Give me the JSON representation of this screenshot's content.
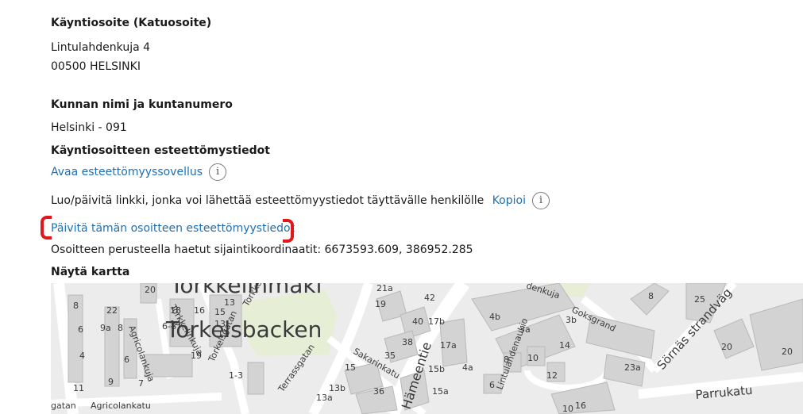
{
  "visiting_address": {
    "heading": "Käyntiosoite (Katuosoite)",
    "street": "Lintulahdenkuja 4",
    "postal": "00500 HELSINKI"
  },
  "municipality": {
    "heading": "Kunnan nimi ja kuntanumero",
    "value": "Helsinki - 091"
  },
  "accessibility": {
    "heading": "Käyntiosoitteen esteettömystiedot",
    "open_app_link": "Avaa esteettömyyssovellus",
    "share_text": "Luo/päivitä linkki, jonka voi lähettää esteettömyystiedot täyttävälle henkilölle",
    "copy_link": "Kopioi",
    "update_link": "Päivitä tämän osoitteen esteettömyystiedot",
    "info_glyph": "i"
  },
  "coordinates": {
    "label": "Osoitteen perusteella haetut sijaintikoordinaatit:",
    "value": "6673593.609, 386952.285"
  },
  "map": {
    "heading": "Näytä kartta",
    "place_labels": {
      "torkkelinmaki": "Torkkelinmäki",
      "torkelsbacken": "Torkelsbacken",
      "hameentie": "Hämeentie",
      "sornas_strandvag": "Sörnäs strandväg",
      "parrukatu": "Parrukatu",
      "agricolankuja": "Agricolankuja",
      "agricolankatu": "Agricolankatu",
      "agricolangatan": "gatan",
      "terrassgatan": "Terrassgatan",
      "sakarinkatu": "Sakarinkatu",
      "lintulahdenaukio": "Lintulahdenaukio",
      "goksgrand": "Goksgrand",
      "torkkelinkuja": "Torkkelinkuja",
      "torkelsgatan": "Torkelsgatan",
      "torkkel": "Torkkel",
      "lahdenkuja": "denkuja"
    },
    "house_numbers": [
      "8",
      "6",
      "4",
      "11",
      "22",
      "9a",
      "8",
      "6",
      "9",
      "7",
      "20",
      "18",
      "16",
      "14",
      "6-8",
      "13",
      "15",
      "13",
      "11",
      "19",
      "1-3",
      "21a",
      "19",
      "42",
      "40",
      "38",
      "35",
      "36",
      "15",
      "13b",
      "13a",
      "17b",
      "17a",
      "15b",
      "15a",
      "4b",
      "3a",
      "3b",
      "14",
      "4a",
      "8",
      "10",
      "12",
      "6",
      "10",
      "16",
      "23a",
      "8",
      "25",
      "20",
      "20"
    ]
  },
  "colors": {
    "link": "#1f6fb2",
    "highlight_bracket": "#e2171c",
    "map_background": "#ececec",
    "map_building": "#d3d3d3",
    "map_green": "#e6efd6",
    "map_road": "#ffffff"
  }
}
